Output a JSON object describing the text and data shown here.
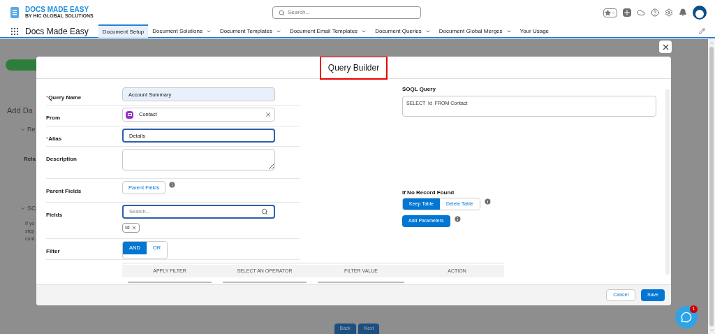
{
  "header": {
    "logo_title": "DOCS MADE EASY",
    "logo_subtitle": "BY HIC GLOBAL SOLUTIONS",
    "search": {
      "placeholder": "Search..."
    }
  },
  "nav": {
    "app_name": "Docs Made Easy",
    "tabs": [
      {
        "label": "Document Setup",
        "selected": true,
        "has_menu": false
      },
      {
        "label": "Document Solutions",
        "selected": false,
        "has_menu": true
      },
      {
        "label": "Document Templates",
        "selected": false,
        "has_menu": true
      },
      {
        "label": "Document Email Templates",
        "selected": false,
        "has_menu": true
      },
      {
        "label": "Document Queries",
        "selected": false,
        "has_menu": true
      },
      {
        "label": "Document Global Merges",
        "selected": false,
        "has_menu": true
      },
      {
        "label": "Your Usage",
        "selected": false,
        "has_menu": false
      }
    ]
  },
  "background": {
    "heading": "Add Da",
    "section_1": "Re",
    "card_label": "Rela",
    "section_2": "SC",
    "text_lines": [
      "If yo",
      "step",
      "cont"
    ],
    "buttons": [
      "Back",
      "Next"
    ]
  },
  "modal": {
    "title": "Query Builder",
    "fields": [
      {
        "kind": "text",
        "marker": "*",
        "label": "Query Name",
        "value": "Account Summary",
        "focused": false
      },
      {
        "kind": "lookup",
        "label": "From",
        "value": "Contact"
      },
      {
        "kind": "text",
        "marker": "*",
        "label": "Alias",
        "value": "Details",
        "focused": true
      },
      {
        "kind": "textarea",
        "label": "Description"
      },
      {
        "kind": "button",
        "label": "Parent Fields",
        "button": "Parent Fields"
      },
      {
        "kind": "search",
        "label": "Fields",
        "placeholder": "Search...",
        "chips": [
          "Id"
        ]
      },
      {
        "kind": "toggle",
        "label": "Filter",
        "options": [
          {
            "label": "AND",
            "selected": true
          },
          {
            "label": "OR",
            "selected": false
          }
        ]
      }
    ],
    "filter_table": {
      "columns": [
        "APPLY FILTER",
        "SELECT AN OPERATOR",
        "FILTER VALUE",
        "ACTION"
      ]
    },
    "soql": {
      "label": "SOQL Query",
      "value": "SELECT  Id  FROM Contact"
    },
    "no_record": {
      "label": "If No Record Found",
      "options": [
        {
          "label": "Keep Table",
          "selected": true
        },
        {
          "label": "Delete Table",
          "selected": false
        }
      ]
    },
    "add_parameters": "Add Parameters",
    "footer": {
      "cancel": "Cancel",
      "save": "Save"
    }
  },
  "chat": {
    "badge": "1"
  }
}
